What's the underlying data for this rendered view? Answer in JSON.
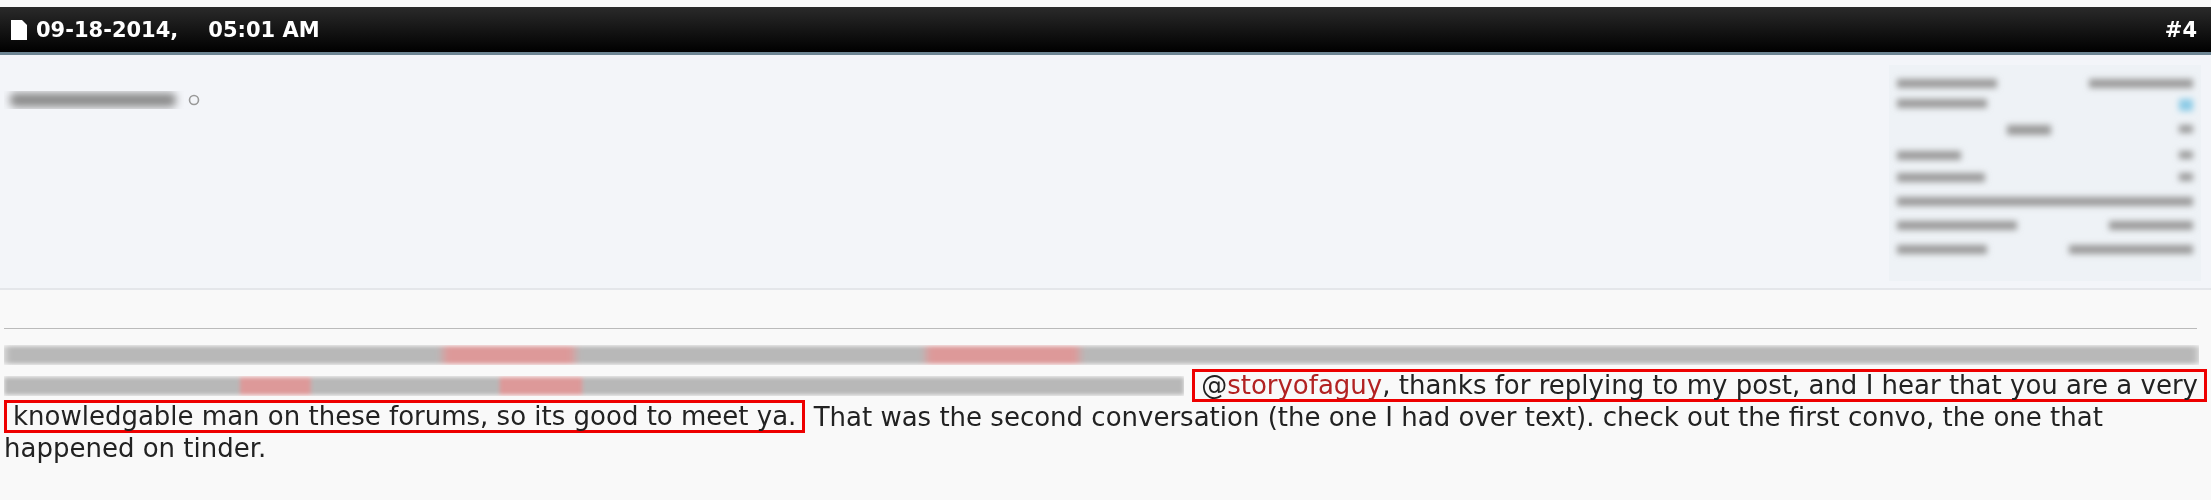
{
  "post_header": {
    "date": "09-18-2014,",
    "time": "05:01 AM",
    "post_number": "#4"
  },
  "post_body": {
    "lines": [
      {
        "segments": [
          {
            "kind": "blurred"
          }
        ]
      },
      {
        "segments": [
          {
            "kind": "blurred"
          },
          {
            "kind": "highlight",
            "parts": [
              {
                "kind": "text",
                "text": "@"
              },
              {
                "kind": "mention",
                "text": "storyofaguy"
              },
              {
                "kind": "text",
                "text": ", thanks for replying to my post, and I hear that you are a very"
              }
            ]
          }
        ]
      },
      {
        "segments": [
          {
            "kind": "highlight",
            "parts": [
              {
                "kind": "text",
                "text": "knowledgable man on these forums, so its good to meet ya."
              }
            ]
          },
          {
            "kind": "text",
            "text": " That was the second conversation (the one I had over text). check out the first convo, the one that"
          }
        ]
      },
      {
        "segments": [
          {
            "kind": "text",
            "text": "happened on tinder."
          }
        ]
      }
    ]
  }
}
